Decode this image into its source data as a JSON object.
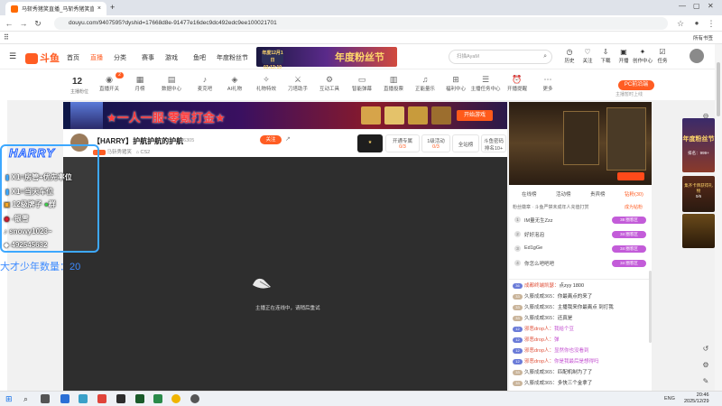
{
  "browser": {
    "tab_title": "马斩秀猪笑直播_马斩秀猪笑直",
    "url": "douyu.com/9407595?dyshid=17668d8e-91477e16dec9dc492edc9ee100021701",
    "new_tab": "+",
    "close": "×",
    "bookmarks_label": "所有书签"
  },
  "header": {
    "logo": "斗鱼",
    "nav": [
      "首页",
      "直播",
      "分类",
      "赛事",
      "游戏",
      "鱼吧",
      "年度粉丝节"
    ],
    "banner_text": "年度粉丝节",
    "banner_pill": "年度12月1日 03:13:10",
    "search_placeholder": "扫描AyaM",
    "icons": [
      "历史",
      "关注",
      "下载",
      "开播",
      "创作中心",
      "任务"
    ]
  },
  "toolbar": {
    "level_num": "12",
    "level_label": "主播粉位",
    "items": [
      "直播开关",
      "月榜",
      "数据中心",
      "麦克吧",
      "AI礼物",
      "礼物特效",
      "刀塔助手",
      "互动工具",
      "智能弹幕",
      "直播投票",
      "正能量乐",
      "福利中心",
      "主播任务中心",
      "开播提醒",
      "更多"
    ],
    "badge_count": "2",
    "pc_button": "PC前沿端",
    "pc_sub": "主播暂时上线"
  },
  "promo": {
    "title": "★一人一服·零氪打金★",
    "start": "开始游戏"
  },
  "room": {
    "title": "【HARRY】护航护航的护航",
    "viewer_count": "46305",
    "follow": "关注",
    "meta_id": "马斩秀猪笑",
    "meta_num": "CS2",
    "box1_top": "开通专属",
    "box1_val": "0/3",
    "box2_top": "1级活动",
    "box2_val": "0/3",
    "box3": "全站榜",
    "box4_top": "斗鱼密码",
    "box4_val": "排名10+"
  },
  "video": {
    "loading_text": "主播正在连线中，请稍后重试"
  },
  "overlay": {
    "name": "HARRY",
    "line1": "X1=房管+优先率位",
    "line2": "X1=当天车位",
    "line3": "12级牌子",
    "line3b": "群",
    "line4": "-银雪",
    "line5": "snowy1023~",
    "line6": "492545632",
    "juvenile": "大才少年数量：20"
  },
  "right": {
    "tabs": [
      "在线榜",
      "活动榜",
      "贵宾榜",
      "钻粉(30)"
    ],
    "rank_head": "粉丝徽章 · 斗鱼严禁未成年人充值打赏",
    "rank_link": "成为钻粉",
    "rank": [
      {
        "n": "1",
        "user": "IM量无生Zzz",
        "badge": "38 圈客区"
      },
      {
        "n": "2",
        "user": "好好泡泡",
        "badge": "34 圈客区"
      },
      {
        "n": "3",
        "user": "Ed1gGe",
        "badge": "34 圈客区"
      },
      {
        "n": "4",
        "user": "你怎么吧吧吧",
        "badge": "34 圈客区"
      }
    ],
    "chat": [
      {
        "lv": "36",
        "nick": "成都终端凯瑟：",
        "msg": "点zyy 1800",
        "nick_red": true,
        "msg_purple": false
      },
      {
        "lv": "33",
        "nick": "久藤成威365：",
        "msg": "你最离点的来了",
        "nick_red": false,
        "msg_purple": false
      },
      {
        "lv": "33",
        "nick": "久藤成威365：",
        "msg": "主播我来你最离点 到打我",
        "nick_red": false,
        "msg_purple": false
      },
      {
        "lv": "33",
        "nick": "久藤成威365：",
        "msg": "还真是",
        "nick_red": false,
        "msg_purple": false
      },
      {
        "lv": "12",
        "nick": "邪恶drop人：",
        "msg": "我给个豆",
        "nick_red": true,
        "msg_purple": true
      },
      {
        "lv": "12",
        "nick": "邪恶drop人：",
        "msg": "弹",
        "nick_red": true,
        "msg_purple": true
      },
      {
        "lv": "12",
        "nick": "邪恶drop人：",
        "msg": "显然你也没看到",
        "nick_red": true,
        "msg_purple": true
      },
      {
        "lv": "12",
        "nick": "邪恶drop人：",
        "msg": "你是我最后是想得吗",
        "nick_red": true,
        "msg_purple": true
      },
      {
        "lv": "33",
        "nick": "久藤成威365：",
        "msg": "匹配机制为了了",
        "nick_red": false,
        "msg_purple": false
      },
      {
        "lv": "33",
        "nick": "久藤成威365：",
        "msg": "多快三个金拿了",
        "nick_red": false,
        "msg_purple": false
      }
    ]
  },
  "ads": {
    "rank_label": "排名：999+",
    "ad2": "集齐卡牌获得礼物",
    "ad2_count": "0/6"
  },
  "taskbar": {
    "time": "20:46",
    "date": "2025/12/29",
    "lang": "ENG"
  },
  "colors": {
    "accent": "#ff5d23",
    "badge_purple": "#c35cd9",
    "overlay_border": "#3da8ff"
  }
}
